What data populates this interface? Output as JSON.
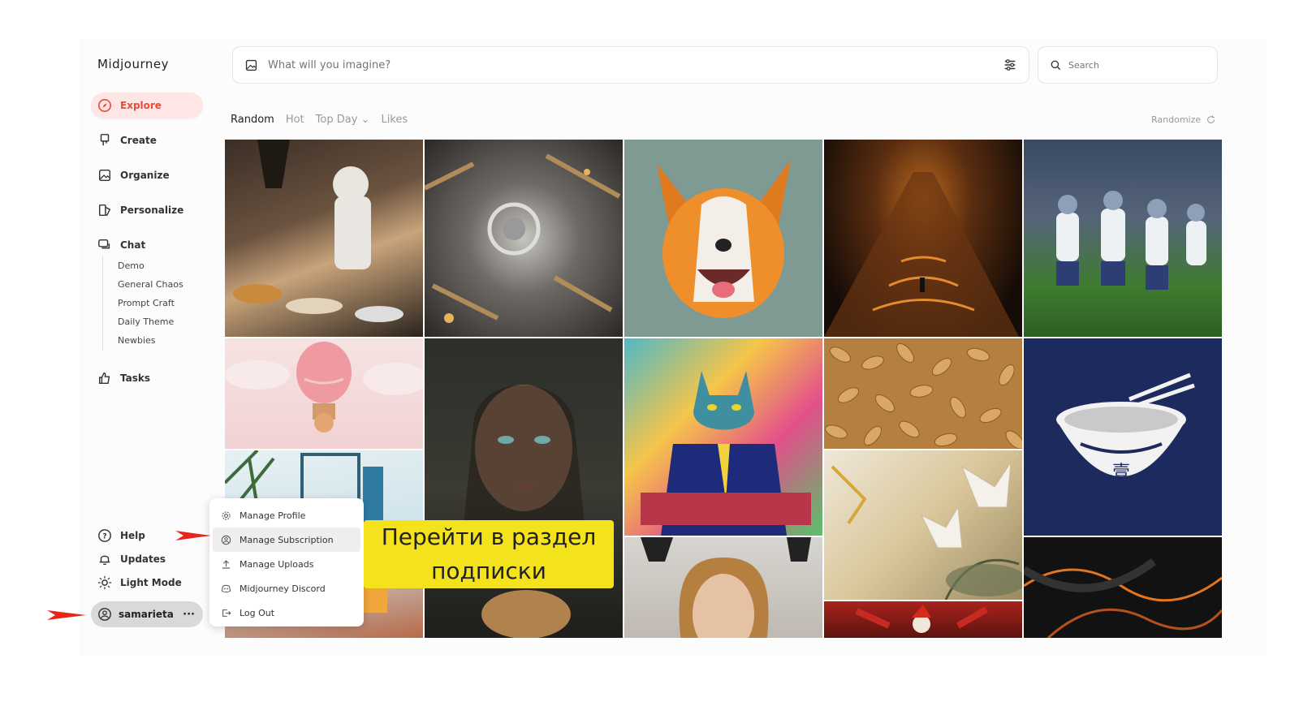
{
  "app": {
    "brand": "Midjourney"
  },
  "nav": [
    {
      "id": "explore",
      "label": "Explore",
      "icon": "compass-icon",
      "active": true
    },
    {
      "id": "create",
      "label": "Create",
      "icon": "brush-icon"
    },
    {
      "id": "organize",
      "label": "Organize",
      "icon": "image-icon"
    },
    {
      "id": "personalize",
      "label": "Personalize",
      "icon": "personalize-icon"
    },
    {
      "id": "chat",
      "label": "Chat",
      "icon": "chat-icon"
    },
    {
      "id": "tasks",
      "label": "Tasks",
      "icon": "thumbs-up-icon"
    }
  ],
  "chat_rooms": [
    "Demo",
    "General Chaos",
    "Prompt Craft",
    "Daily Theme",
    "Newbies"
  ],
  "bottom_nav": {
    "help": "Help",
    "updates": "Updates",
    "light_mode": "Light Mode",
    "username": "samarieta",
    "more": "···"
  },
  "prompt": {
    "placeholder": "What will you imagine?"
  },
  "search": {
    "placeholder": "Search"
  },
  "tabs": [
    "Random",
    "Hot",
    "Top Day",
    "Likes"
  ],
  "active_tab": "Random",
  "randomize_label": "Randomize",
  "user_menu": [
    {
      "label": "Manage Profile",
      "icon": "gear-icon"
    },
    {
      "label": "Manage Subscription",
      "icon": "user-circle-icon",
      "highlighted": true
    },
    {
      "label": "Manage Uploads",
      "icon": "upload-icon"
    },
    {
      "label": "Midjourney Discord",
      "icon": "discord-icon"
    },
    {
      "label": "Log Out",
      "icon": "logout-icon"
    }
  ],
  "callout": {
    "line1": "Перейти в раздел",
    "line2": "подписки"
  },
  "colors": {
    "accent": "#e94a3a",
    "callout": "#f4e21c",
    "arrow": "#e8251b"
  }
}
